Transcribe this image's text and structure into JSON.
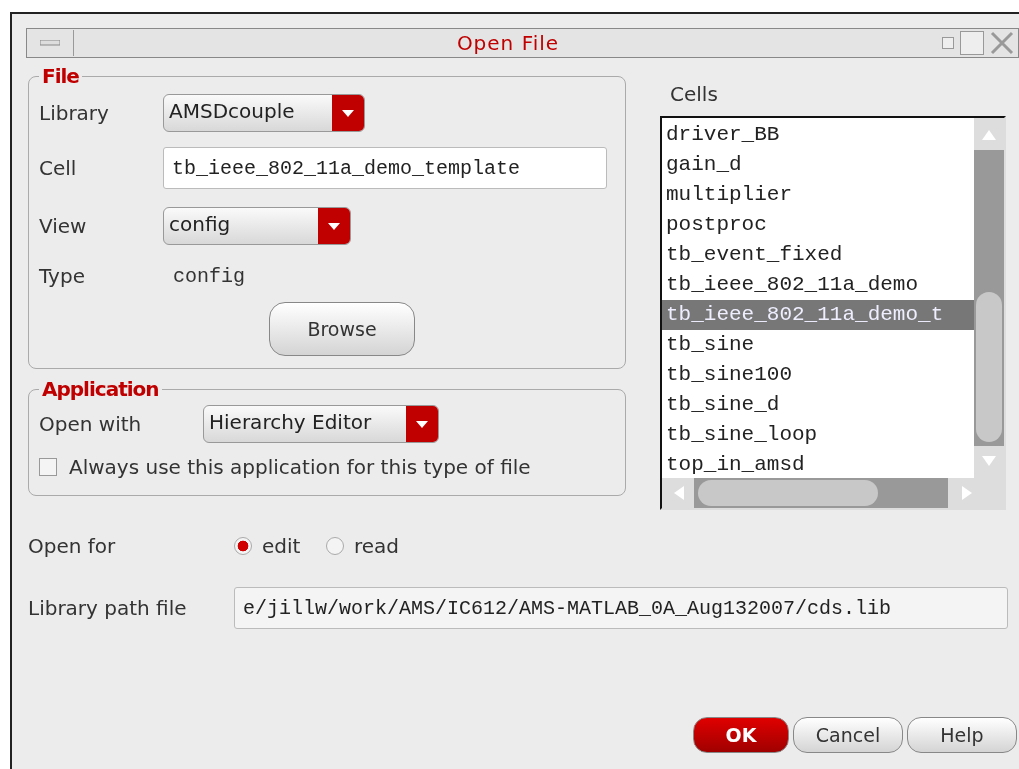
{
  "window": {
    "title": "Open File"
  },
  "file_group": {
    "title": "File",
    "library": {
      "label": "Library",
      "value": "AMSDcouple"
    },
    "cell": {
      "label": "Cell",
      "value": "tb_ieee_802_11a_demo_template"
    },
    "view": {
      "label": "View",
      "value": "config"
    },
    "type": {
      "label": "Type",
      "value": "config"
    },
    "browse_button": "Browse"
  },
  "application_group": {
    "title": "Application",
    "open_with": {
      "label": "Open with",
      "value": "Hierarchy Editor"
    },
    "always_use": {
      "label": "Always use this application for this type of file",
      "checked": false
    }
  },
  "cells": {
    "label": "Cells",
    "items": [
      {
        "text": "driver_BB",
        "selected": false
      },
      {
        "text": "gain_d",
        "selected": false
      },
      {
        "text": "multiplier",
        "selected": false
      },
      {
        "text": "postproc",
        "selected": false
      },
      {
        "text": "tb_event_fixed",
        "selected": false
      },
      {
        "text": "tb_ieee_802_11a_demo",
        "selected": false
      },
      {
        "text": "tb_ieee_802_11a_demo_t",
        "selected": true
      },
      {
        "text": "tb_sine",
        "selected": false
      },
      {
        "text": "tb_sine100",
        "selected": false
      },
      {
        "text": "tb_sine_d",
        "selected": false
      },
      {
        "text": "tb_sine_loop",
        "selected": false
      },
      {
        "text": "top_in_amsd",
        "selected": false
      }
    ]
  },
  "open_for": {
    "label": "Open for",
    "options": [
      {
        "label": "edit",
        "selected": true
      },
      {
        "label": "read",
        "selected": false
      }
    ]
  },
  "library_path": {
    "label": "Library path file",
    "value": "e/jillw/work/AMS/IC612/AMS-MATLAB_0A_Aug132007/cds.lib"
  },
  "buttons": [
    {
      "label": "OK",
      "kind": "default"
    },
    {
      "label": "Cancel",
      "kind": "normal"
    },
    {
      "label": "Help",
      "kind": "normal"
    }
  ]
}
